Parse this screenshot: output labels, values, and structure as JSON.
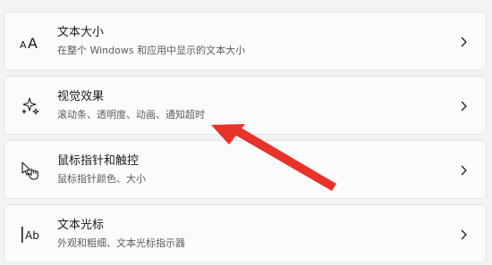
{
  "settings": {
    "items": [
      {
        "title": "文本大小",
        "subtitle": "在整个 Windows 和应用中显示的文本大小",
        "icon": "text-size-icon"
      },
      {
        "title": "视觉效果",
        "subtitle": "滚动条、透明度、动画、通知超时",
        "icon": "sparkle-icon"
      },
      {
        "title": "鼠标指针和触控",
        "subtitle": "鼠标指针颜色、大小",
        "icon": "pointer-touch-icon"
      },
      {
        "title": "文本光标",
        "subtitle": "外观和粗细、文本光标指示器",
        "icon": "text-cursor-icon"
      }
    ]
  },
  "annotation": {
    "color": "#e8332a",
    "target": "视觉效果"
  }
}
